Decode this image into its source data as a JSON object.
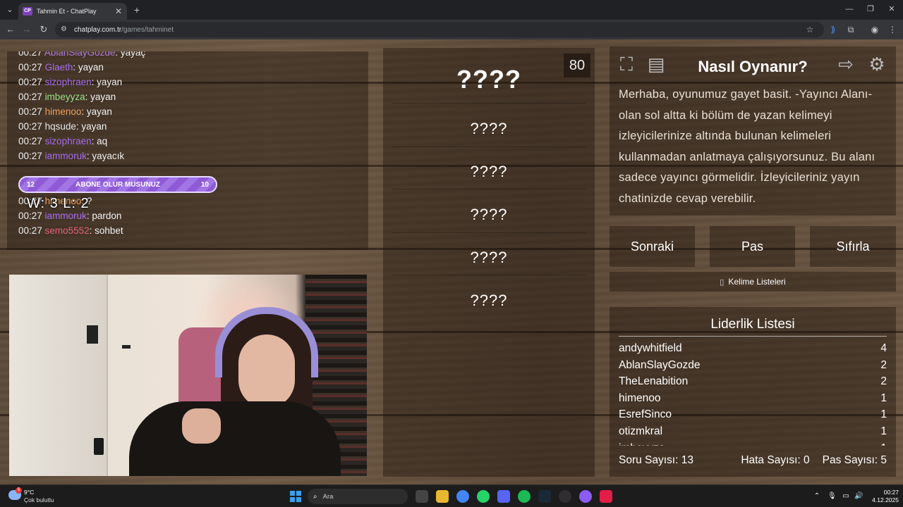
{
  "browser": {
    "tab_title": "Tahmin Et - ChatPlay",
    "tab_favicon": "CP",
    "url_host": "chatplay.com.tr",
    "url_path": "/games/tahminet",
    "icons": {
      "tab_menu": "⌄",
      "close": "✕",
      "new_tab": "+",
      "minimize": "—",
      "restore": "❐",
      "win_close": "✕",
      "back": "←",
      "forward": "→",
      "reload": "↻",
      "site": "⚙",
      "star": "☆",
      "ext1": "⟫",
      "ext2": "⧉",
      "profile": "◉",
      "menu": "⋮"
    }
  },
  "chat": {
    "messages": [
      {
        "time": "00:27",
        "user": "AblanSlayGozde",
        "color": "#b07ad8",
        "text": ": yayaç"
      },
      {
        "time": "00:27",
        "user": "Glaeth",
        "color": "#a66bf0",
        "text": ": yayan"
      },
      {
        "time": "00:27",
        "user": "sizophraen",
        "color": "#a66bf0",
        "text": ": yayan"
      },
      {
        "time": "00:27",
        "user": "imbeyyza",
        "color": "#9be08a",
        "text": ": yayan"
      },
      {
        "time": "00:27",
        "user": "himenoo",
        "color": "#f0a060",
        "text": ": yayan"
      },
      {
        "time": "00:27",
        "user": "hqsude",
        "color": "#e8e8e8",
        "text": ": yayan"
      },
      {
        "time": "00:27",
        "user": "sizophraen",
        "color": "#a66bf0",
        "text": ": aq"
      },
      {
        "time": "00:27",
        "user": "iammoruk",
        "color": "#a66bf0",
        "text": ": yayacık"
      },
      {
        "time": "00:27",
        "user": "iammoruk",
        "color": "#a66bf0",
        "text": ": yayamcık"
      },
      {
        "time": "00:27",
        "user": "himenoo",
        "color": "#f0a060",
        "text": ": ?"
      },
      {
        "time": "00:27",
        "user": "iammoruk",
        "color": "#a66bf0",
        "text": ": pardon"
      },
      {
        "time": "00:27",
        "user": "semo5552",
        "color": "#e0607a",
        "text": ": sohbet"
      }
    ],
    "abone": {
      "left": "12",
      "label": "ABONE OLUR MUSUNUZ",
      "right": "10",
      "progress": 0.55
    },
    "wl": "W: 3 L: 2"
  },
  "game": {
    "timer": "80",
    "words": [
      "????",
      "????",
      "????",
      "????",
      "????",
      "????"
    ]
  },
  "info": {
    "title": "Nasıl Oynanır?",
    "text": "Merhaba, oyunumuz gayet basit. -Yayıncı Alanı- olan sol altta ki bölüm de yazan kelimeyi izleyicilerinize altında bulunan kelimeleri kullanmadan anlatmaya çalışıyorsunuz. Bu alanı sadece yayıncı görmelidir. İzleyicileriniz yayın chatinizde cevap verebilir.",
    "icons": {
      "fullscreen": "⛶",
      "notes": "▤",
      "exit": "⇨",
      "settings": "⚙"
    }
  },
  "controls": {
    "next": "Sonraki",
    "pass": "Pas",
    "reset": "Sıfırla",
    "lists": "Kelime Listeleri",
    "lists_icon": "▯"
  },
  "leaderboard": {
    "title": "Liderlik Listesi",
    "rows": [
      {
        "name": "andywhitfield",
        "score": "4"
      },
      {
        "name": "AblanSlayGozde",
        "score": "2"
      },
      {
        "name": "TheLenabition",
        "score": "2"
      },
      {
        "name": "himenoo",
        "score": "1"
      },
      {
        "name": "EsrefSinco",
        "score": "1"
      },
      {
        "name": "otizmkral",
        "score": "1"
      },
      {
        "name": "imbeyyza",
        "score": "1"
      }
    ],
    "questions": "Soru Sayısı: 13",
    "errors": "Hata Sayısı: 0",
    "passes": "Pas Sayısı: 5"
  },
  "taskbar": {
    "weather_temp": "9°C",
    "weather_desc": "Çok bulutlu",
    "weather_badge": "5",
    "search": "Ara",
    "clock_time": "00:27",
    "clock_date": "4.12.2025",
    "apps": [
      "task-view",
      "file-explorer",
      "chrome",
      "whatsapp",
      "discord",
      "spotify",
      "steam",
      "obs",
      "app-circle",
      "app-red"
    ]
  }
}
